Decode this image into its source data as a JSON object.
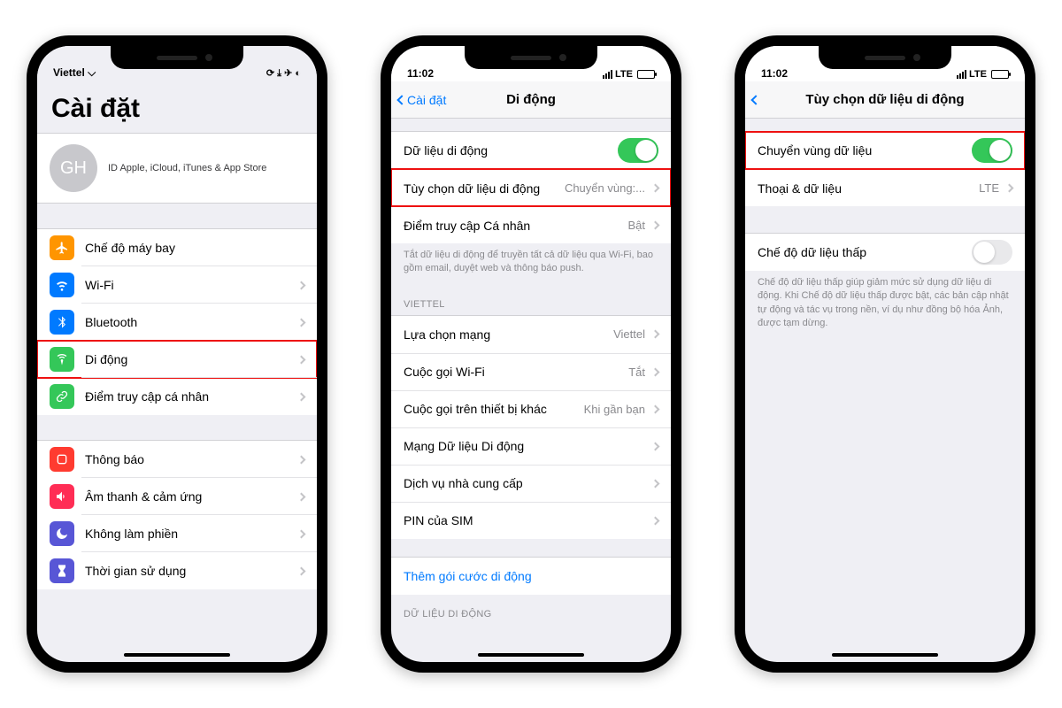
{
  "phone1": {
    "status": {
      "carrier": "Viettel",
      "wifi_icon": "wifi"
    },
    "title": "Cài đặt",
    "profile": {
      "initials": "GH",
      "sub": "ID Apple, iCloud, iTunes & App Store"
    },
    "group1": [
      {
        "icon": "airplane",
        "color": "ic-orange",
        "label": "Chế độ máy bay",
        "name": "airplane-mode"
      },
      {
        "icon": "wifi",
        "color": "ic-blue",
        "label": "Wi-Fi",
        "chev": true,
        "name": "wifi"
      },
      {
        "icon": "bluetooth",
        "color": "ic-blue",
        "label": "Bluetooth",
        "chev": true,
        "name": "bluetooth"
      },
      {
        "icon": "antenna",
        "color": "ic-green",
        "label": "Di động",
        "chev": true,
        "highlight": true,
        "name": "cellular"
      },
      {
        "icon": "link",
        "color": "ic-green",
        "label": "Điểm truy cập cá nhân",
        "chev": true,
        "name": "hotspot"
      }
    ],
    "group2": [
      {
        "icon": "bell",
        "color": "ic-red",
        "label": "Thông báo",
        "chev": true,
        "name": "notifications"
      },
      {
        "icon": "speaker",
        "color": "ic-pink",
        "label": "Âm thanh & cảm ứng",
        "chev": true,
        "name": "sounds"
      },
      {
        "icon": "moon",
        "color": "ic-purple",
        "label": "Không làm phiền",
        "chev": true,
        "name": "dnd"
      },
      {
        "icon": "hourglass",
        "color": "ic-indigo",
        "label": "Thời gian sử dụng",
        "chev": true,
        "name": "screentime"
      }
    ]
  },
  "phone2": {
    "status": {
      "time": "11:02",
      "net": "LTE"
    },
    "nav": {
      "back": "Cài đặt",
      "title": "Di động"
    },
    "group1": [
      {
        "label": "Dữ liệu di động",
        "toggle": "on",
        "name": "cellular-data"
      },
      {
        "label": "Tùy chọn dữ liệu di động",
        "value": "Chuyển vùng:...",
        "chev": true,
        "highlight": true,
        "name": "cellular-data-options"
      },
      {
        "label": "Điểm truy cập Cá nhân",
        "value": "Bật",
        "chev": true,
        "name": "personal-hotspot"
      }
    ],
    "footer1": "Tắt dữ liệu di động để truyền tất cả dữ liệu qua Wi-Fi, bao gồm email, duyệt web và thông báo push.",
    "header_viettel": "VIETTEL",
    "group2": [
      {
        "label": "Lựa chọn mạng",
        "value": "Viettel",
        "chev": true,
        "name": "network-selection"
      },
      {
        "label": "Cuộc gọi Wi-Fi",
        "value": "Tắt",
        "chev": true,
        "name": "wifi-calling"
      },
      {
        "label": "Cuộc gọi trên thiết bị khác",
        "value": "Khi gần bạn",
        "chev": true,
        "name": "calls-other-devices"
      },
      {
        "label": "Mạng Dữ liệu Di động",
        "chev": true,
        "name": "mobile-data-network"
      },
      {
        "label": "Dịch vụ nhà cung cấp",
        "chev": true,
        "name": "carrier-services"
      },
      {
        "label": "PIN của SIM",
        "chev": true,
        "name": "sim-pin"
      }
    ],
    "add_plan": "Thêm gói cước di động",
    "header_data": "DỮ LIỆU DI ĐỘNG"
  },
  "phone3": {
    "status": {
      "time": "11:02",
      "net": "LTE"
    },
    "nav": {
      "title": "Tùy chọn dữ liệu di động"
    },
    "group1": [
      {
        "label": "Chuyển vùng dữ liệu",
        "toggle": "on",
        "highlight": true,
        "name": "data-roaming"
      },
      {
        "label": "Thoại & dữ liệu",
        "value": "LTE",
        "chev": true,
        "name": "voice-data"
      }
    ],
    "group2": [
      {
        "label": "Chế độ dữ liệu thấp",
        "toggle": "off",
        "name": "low-data-mode"
      }
    ],
    "footer2": "Chế độ dữ liệu thấp giúp giảm mức sử dụng dữ liệu di động. Khi Chế độ dữ liệu thấp được bật, các bản cập nhật tự động và tác vụ trong nền, ví dụ như đồng bộ hóa Ảnh, được tạm dừng."
  }
}
